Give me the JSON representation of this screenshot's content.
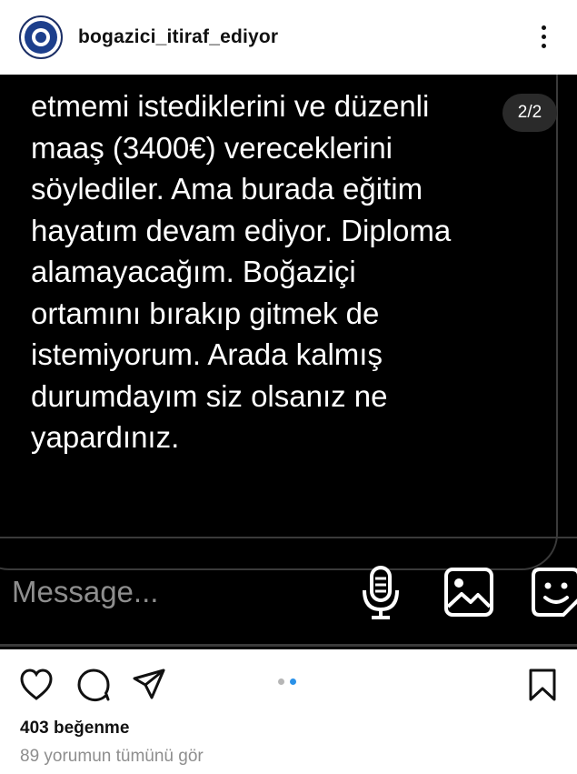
{
  "header": {
    "username": "bogazici_itiraf_ediyor"
  },
  "post": {
    "message_text": "etmemi istediklerini ve düzenli\nmaaş (3400€) vereceklerini\nsöylediler. Ama burada eğitim\nhayatım devam ediyor. Diploma\nalamayacağım. Boğaziçi\nortamını bırakıp gitmek de\nistemiyorum. Arada kalmış\ndurumdayım siz olsanız ne\nyapardınız.",
    "counter": "2/2",
    "composer_placeholder": "Message..."
  },
  "carousel": {
    "total": 2,
    "active": 2,
    "active_color": "#2a91e8"
  },
  "footer": {
    "likes": "403 beğenme",
    "comments_link": "89 yorumun tümünü gör"
  },
  "icons": {
    "more": "more-vertical-icon",
    "mic": "microphone-icon",
    "gallery": "image-gallery-icon",
    "sticker": "sticker-icon",
    "like": "heart-icon",
    "comment": "comment-icon",
    "share": "share-icon",
    "save": "bookmark-icon"
  }
}
